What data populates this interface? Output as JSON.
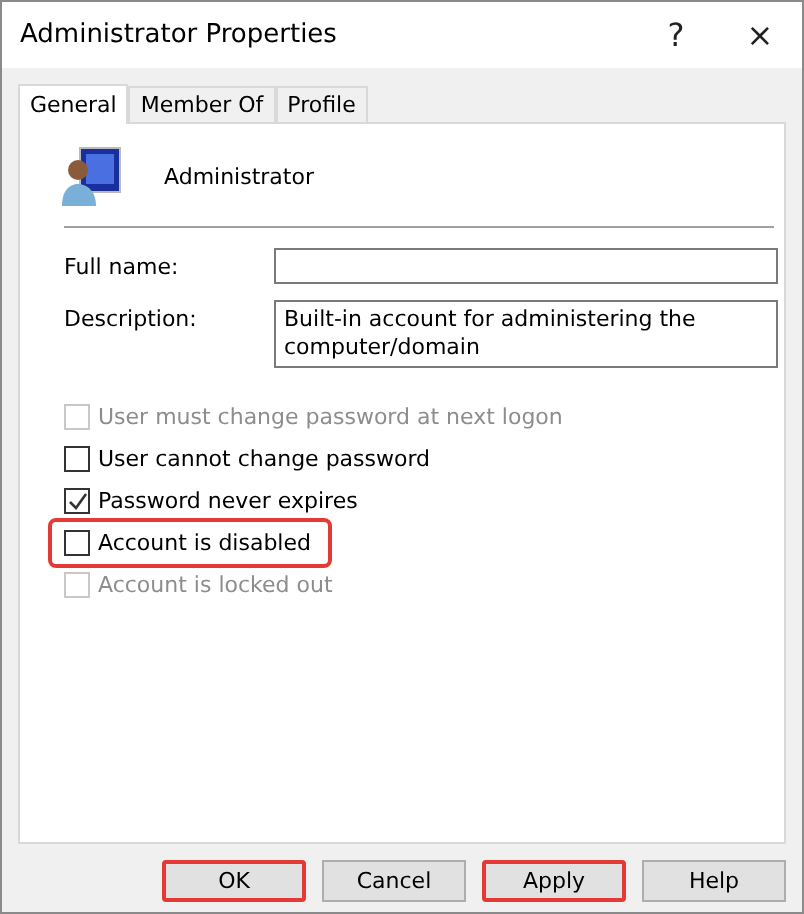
{
  "window": {
    "title": "Administrator Properties",
    "controls": [
      "?",
      "×"
    ]
  },
  "tabs": [
    {
      "label": "General",
      "selected": true
    },
    {
      "label": "Member Of",
      "selected": false
    },
    {
      "label": "Profile",
      "selected": false
    }
  ],
  "user": {
    "name": "Administrator"
  },
  "fields": [
    {
      "label": "Full name:"
    },
    {
      "label": "Description:",
      "value": "Built-in account for administering the computer/domain"
    }
  ],
  "checkboxes": [
    {
      "label": "User must change password at next logon",
      "checked": false,
      "disabled": true,
      "highlighted": false
    },
    {
      "label": "User cannot change password",
      "checked": false,
      "disabled": false,
      "highlighted": false
    },
    {
      "label": "Password never expires",
      "checked": true,
      "disabled": false,
      "highlighted": false
    },
    {
      "label": "Account is disabled",
      "checked": false,
      "disabled": false,
      "highlighted": true
    },
    {
      "label": "Account is locked out",
      "checked": false,
      "disabled": true,
      "highlighted": false
    }
  ],
  "buttons": [
    {
      "label": "OK",
      "highlighted": true
    },
    {
      "label": "Cancel",
      "highlighted": false
    },
    {
      "label": "Apply",
      "highlighted": true
    },
    {
      "label": "Help",
      "highlighted": false
    }
  ]
}
